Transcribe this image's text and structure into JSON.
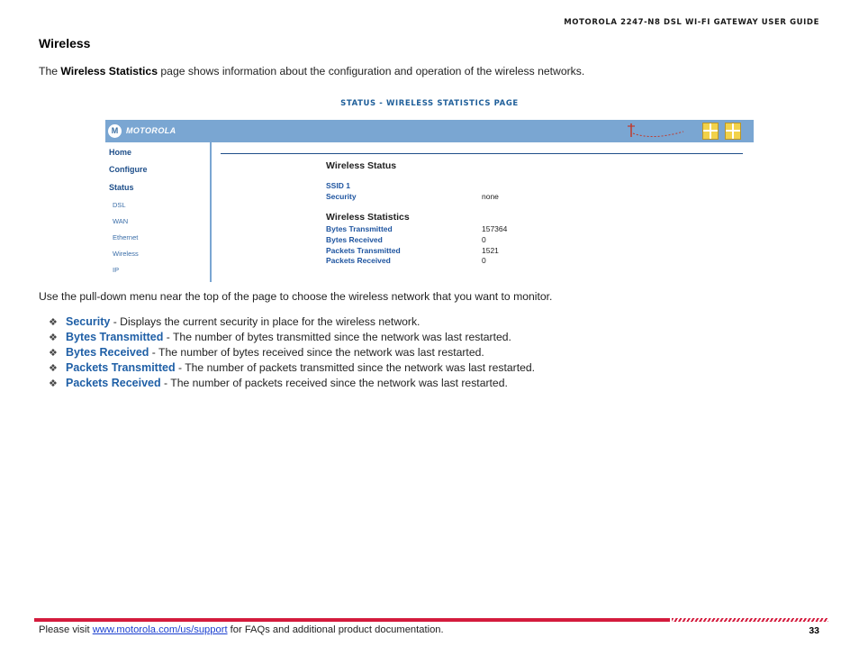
{
  "header": {
    "guide_title": "MOTOROLA 2247-N8 DSL WI-FI GATEWAY USER GUIDE"
  },
  "section": {
    "title": "Wireless",
    "intro_pre": "The ",
    "intro_bold": "Wireless Statistics",
    "intro_post": " page shows information about the configuration and operation of the wireless networks."
  },
  "figure": {
    "caption": "STATUS - WIRELESS STATISTICS PAGE",
    "brand": "MOTOROLA",
    "nav": {
      "home": "Home",
      "configure": "Configure",
      "status": "Status",
      "sub_items": [
        "DSL",
        "WAN",
        "Ethernet",
        "Wireless",
        "IP"
      ]
    },
    "wireless_status": {
      "heading": "Wireless Status",
      "ssid_label": "SSID 1",
      "security_label": "Security",
      "security_value": "none"
    },
    "wireless_statistics": {
      "heading": "Wireless Statistics",
      "rows": [
        {
          "label": "Bytes Transmitted",
          "value": "157364"
        },
        {
          "label": "Bytes Received",
          "value": "0"
        },
        {
          "label": "Packets Transmitted",
          "value": "1521"
        },
        {
          "label": "Packets Received",
          "value": "0"
        }
      ]
    }
  },
  "body_text": "Use the pull-down menu near the top of the page to choose the wireless network that you want to monitor.",
  "bullets": [
    {
      "term": "Security",
      "desc": " - Displays the current security in place for the wireless network."
    },
    {
      "term": "Bytes Transmitted",
      "desc": " - The number of bytes transmitted since the network was last restarted."
    },
    {
      "term": "Bytes Received",
      "desc": " - The number of bytes received since the network was last restarted."
    },
    {
      "term": "Packets Transmitted",
      "desc": " - The number of packets transmitted since the network was last restarted."
    },
    {
      "term": "Packets Received",
      "desc": " - The number of packets received since the network was last restarted."
    }
  ],
  "footer": {
    "pre": "Please visit ",
    "link": "www.motorola.com/us/support",
    "post": " for FAQs and additional product documentation.",
    "page_number": "33"
  },
  "colors": {
    "accent_blue": "#1f5fa6",
    "footer_red": "#d41b3d",
    "ui_bar": "#7aa6d2"
  }
}
